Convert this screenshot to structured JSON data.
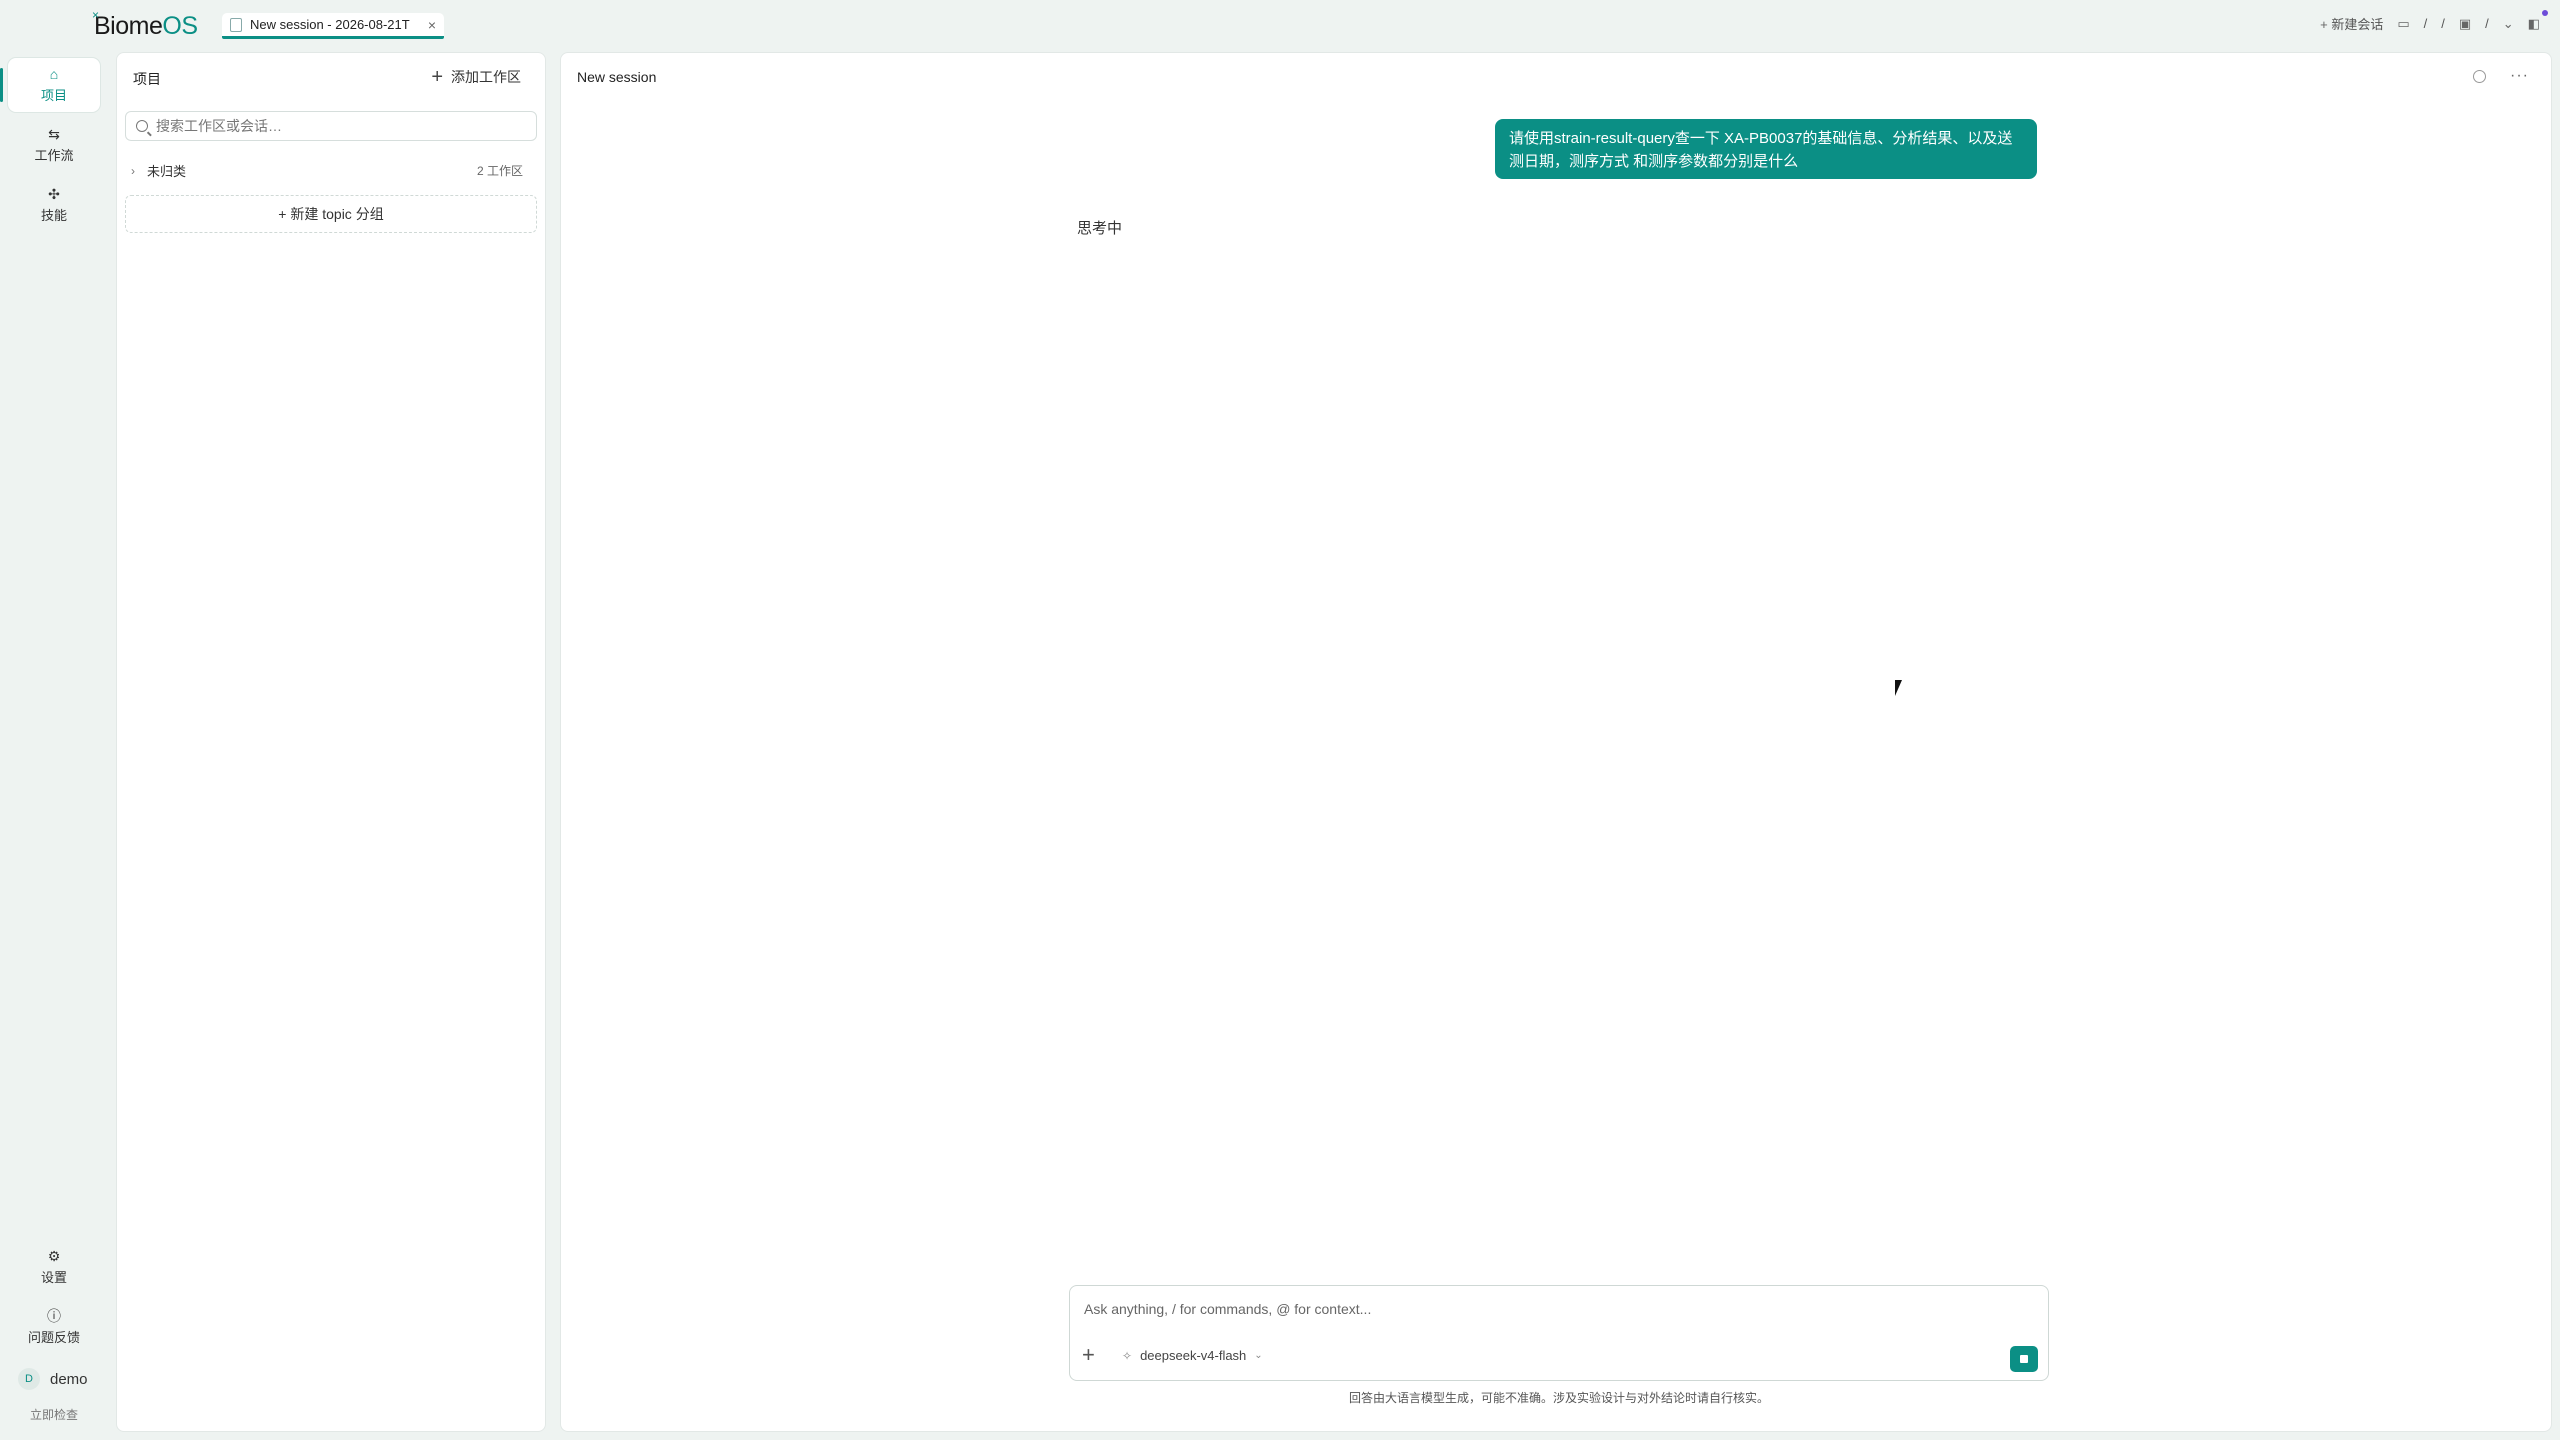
{
  "app": {
    "logo_main": "Biome",
    "logo_accent": "OS",
    "logo_mark": "×"
  },
  "tab": {
    "label": "New session - 2026-08-21T",
    "close": "×"
  },
  "topbar": {
    "new_chat": "新建会话",
    "path_sep1": "/",
    "path_sep2": "/",
    "path_sep3": "/"
  },
  "rail": {
    "items": [
      {
        "label": "项目",
        "icon": "home-icon"
      },
      {
        "label": "工作流",
        "icon": "workflow-icon"
      },
      {
        "label": "技能",
        "icon": "skill-icon"
      }
    ],
    "settings": "设置",
    "feedback": "问题反馈",
    "user_initial": "D",
    "user_name": "demo",
    "check_now": "立即检查"
  },
  "projects": {
    "title": "项目",
    "add_workspace": "添加工作区",
    "search_placeholder": "搜索工作区或会话…",
    "group_name": "未归类",
    "group_count": "2 工作区",
    "new_topic": "+ 新建 topic 分组"
  },
  "main": {
    "title": "New session",
    "user_message": "请使用strain-result-query查一下 XA-PB0037的基础信息、分析结果、以及送测日期，测序方式 和测序参数都分别是什么",
    "thinking": "思考中",
    "composer_placeholder": "Ask anything, / for commands, @ for context...",
    "model": "deepseek-v4-flash",
    "disclaimer": "回答由大语言模型生成，可能不准确。涉及实验设计与对外结论时请自行核实。"
  },
  "colors": {
    "accent": "#0b8f85",
    "background": "#eef3f1"
  }
}
